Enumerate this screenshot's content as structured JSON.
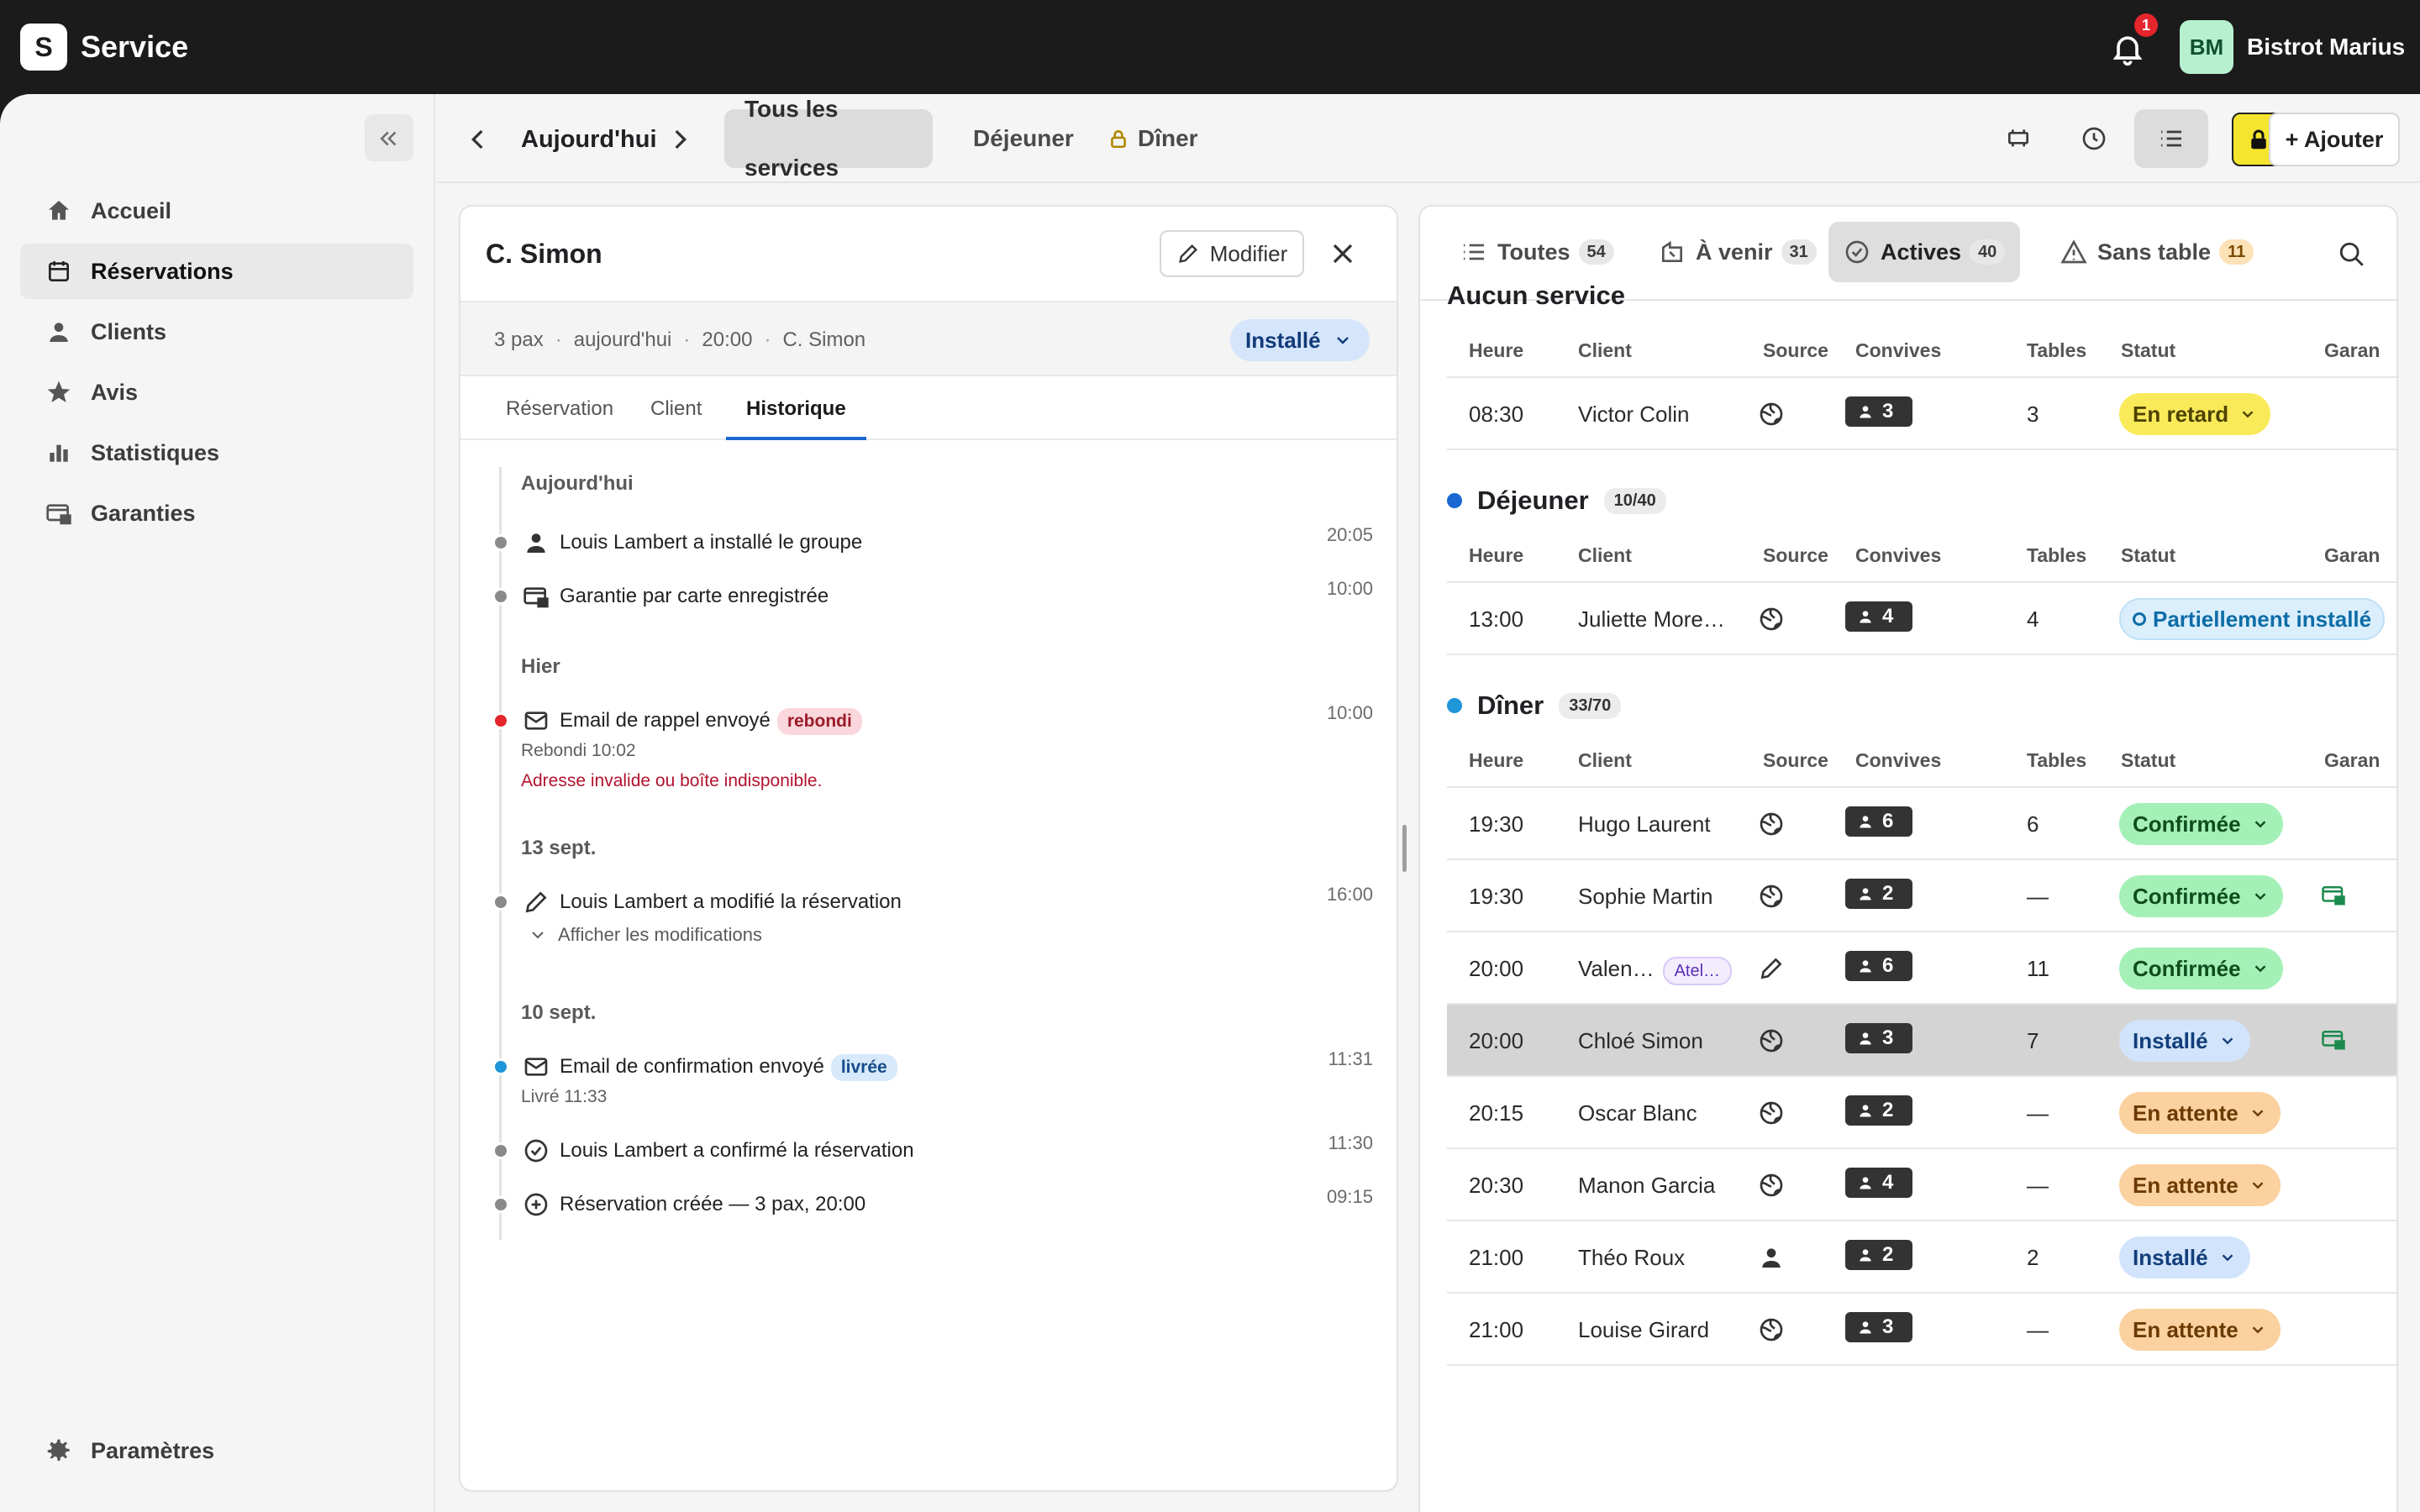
{
  "app": {
    "logo_letter": "S",
    "title": "Service",
    "notification_count": "1",
    "avatar_initials": "BM",
    "user_name": "Bistrot Marius"
  },
  "sidebar": {
    "items": [
      {
        "label": "Accueil",
        "icon": "home-icon"
      },
      {
        "label": "Réservations",
        "icon": "calendar-icon",
        "active": true
      },
      {
        "label": "Clients",
        "icon": "person-icon"
      },
      {
        "label": "Avis",
        "icon": "star-icon"
      },
      {
        "label": "Statistiques",
        "icon": "bar-chart-icon"
      },
      {
        "label": "Garanties",
        "icon": "card-lock-icon"
      }
    ],
    "settings_label": "Paramètres"
  },
  "subheader": {
    "date_label": "Aujourd'hui",
    "service_tabs": [
      "Tous les services",
      "Déjeuner",
      "Dîner"
    ],
    "add_label": "+ Ajouter"
  },
  "detail": {
    "title": "C. Simon",
    "edit_label": "Modifier",
    "summary": {
      "pax": "3 pax",
      "day": "aujourd'hui",
      "time": "20:00",
      "name": "C. Simon"
    },
    "status": "Installé",
    "tabs": [
      "Réservation",
      "Client",
      "Historique"
    ],
    "timeline": {
      "today": "Aujourd'hui",
      "e1_text": "Louis Lambert a installé le groupe",
      "e1_time": "20:05",
      "e2_text": "Garantie par carte enregistrée",
      "e2_time": "10:00",
      "yesterday": "Hier",
      "e3_text": "Email de rappel envoyé",
      "e3_tag": "rebondi",
      "e3_time": "10:00",
      "e3_sub": "Rebondi 10:02",
      "e3_err": "Adresse invalide ou boîte indisponible.",
      "sep13": "13 sept.",
      "e4_text": "Louis Lambert a modifié la réservation",
      "e4_time": "16:00",
      "e4_link": "Afficher les modifications",
      "sep10": "10 sept.",
      "e5_text": "Email de confirmation envoyé",
      "e5_tag": "livrée",
      "e5_time": "11:31",
      "e5_sub": "Livré 11:33",
      "e6_text": "Louis Lambert a confirmé la réservation",
      "e6_time": "11:30",
      "e7_text": "Réservation créée — 3 pax, 20:00",
      "e7_time": "09:15"
    }
  },
  "list": {
    "tabs": [
      {
        "label": "Toutes",
        "count": "54"
      },
      {
        "label": "À venir",
        "count": "31"
      },
      {
        "label": "Actives",
        "count": "40"
      },
      {
        "label": "Sans table",
        "count": "11"
      }
    ],
    "headers": {
      "time": "Heure",
      "client": "Client",
      "source": "Source",
      "guests": "Convives",
      "tables": "Tables",
      "status": "Statut",
      "guarantee": "Garan"
    },
    "sections": [
      {
        "title": "Aucun service",
        "count": "",
        "dot": "",
        "rows": [
          {
            "time": "08:30",
            "client": "Victor Colin",
            "source": "web",
            "guests": "3",
            "tables": "3",
            "status": "En retard",
            "status_color": "yellow"
          }
        ]
      },
      {
        "title": "Déjeuner",
        "count": "10/40",
        "dot": "#1a67d2",
        "rows": [
          {
            "time": "13:00",
            "client": "Juliette More…",
            "source": "web",
            "guests": "4",
            "tables": "4",
            "status": "Partiellement installé",
            "status_color": "partial"
          }
        ]
      },
      {
        "title": "Dîner",
        "count": "33/70",
        "dot": "#1e96d8",
        "rows": [
          {
            "time": "19:30",
            "client": "Hugo Laurent",
            "source": "web",
            "guests": "6",
            "tables": "6",
            "status": "Confirmée",
            "status_color": "green"
          },
          {
            "time": "19:30",
            "client": "Sophie Martin",
            "source": "web",
            "guests": "2",
            "tables": "—",
            "status": "Confirmée",
            "status_color": "green",
            "guarantee": true
          },
          {
            "time": "20:00",
            "client": "Valen…",
            "tag": "Atel…",
            "source": "manual",
            "guests": "6",
            "tables": "11",
            "status": "Confirmée",
            "status_color": "green"
          },
          {
            "time": "20:00",
            "client": "Chloé Simon",
            "source": "web",
            "guests": "3",
            "tables": "7",
            "status": "Installé",
            "status_color": "blue",
            "guarantee": true,
            "selected": true
          },
          {
            "time": "20:15",
            "client": "Oscar Blanc",
            "source": "web",
            "guests": "2",
            "tables": "—",
            "status": "En attente",
            "status_color": "orange"
          },
          {
            "time": "20:30",
            "client": "Manon Garcia",
            "source": "web",
            "guests": "4",
            "tables": "—",
            "status": "En attente",
            "status_color": "orange"
          },
          {
            "time": "21:00",
            "client": "Théo Roux",
            "source": "person",
            "guests": "2",
            "tables": "2",
            "status": "Installé",
            "status_color": "blue"
          },
          {
            "time": "21:00",
            "client": "Louise Girard",
            "source": "web",
            "guests": "3",
            "tables": "—",
            "status": "En attente",
            "status_color": "orange"
          }
        ]
      }
    ]
  }
}
